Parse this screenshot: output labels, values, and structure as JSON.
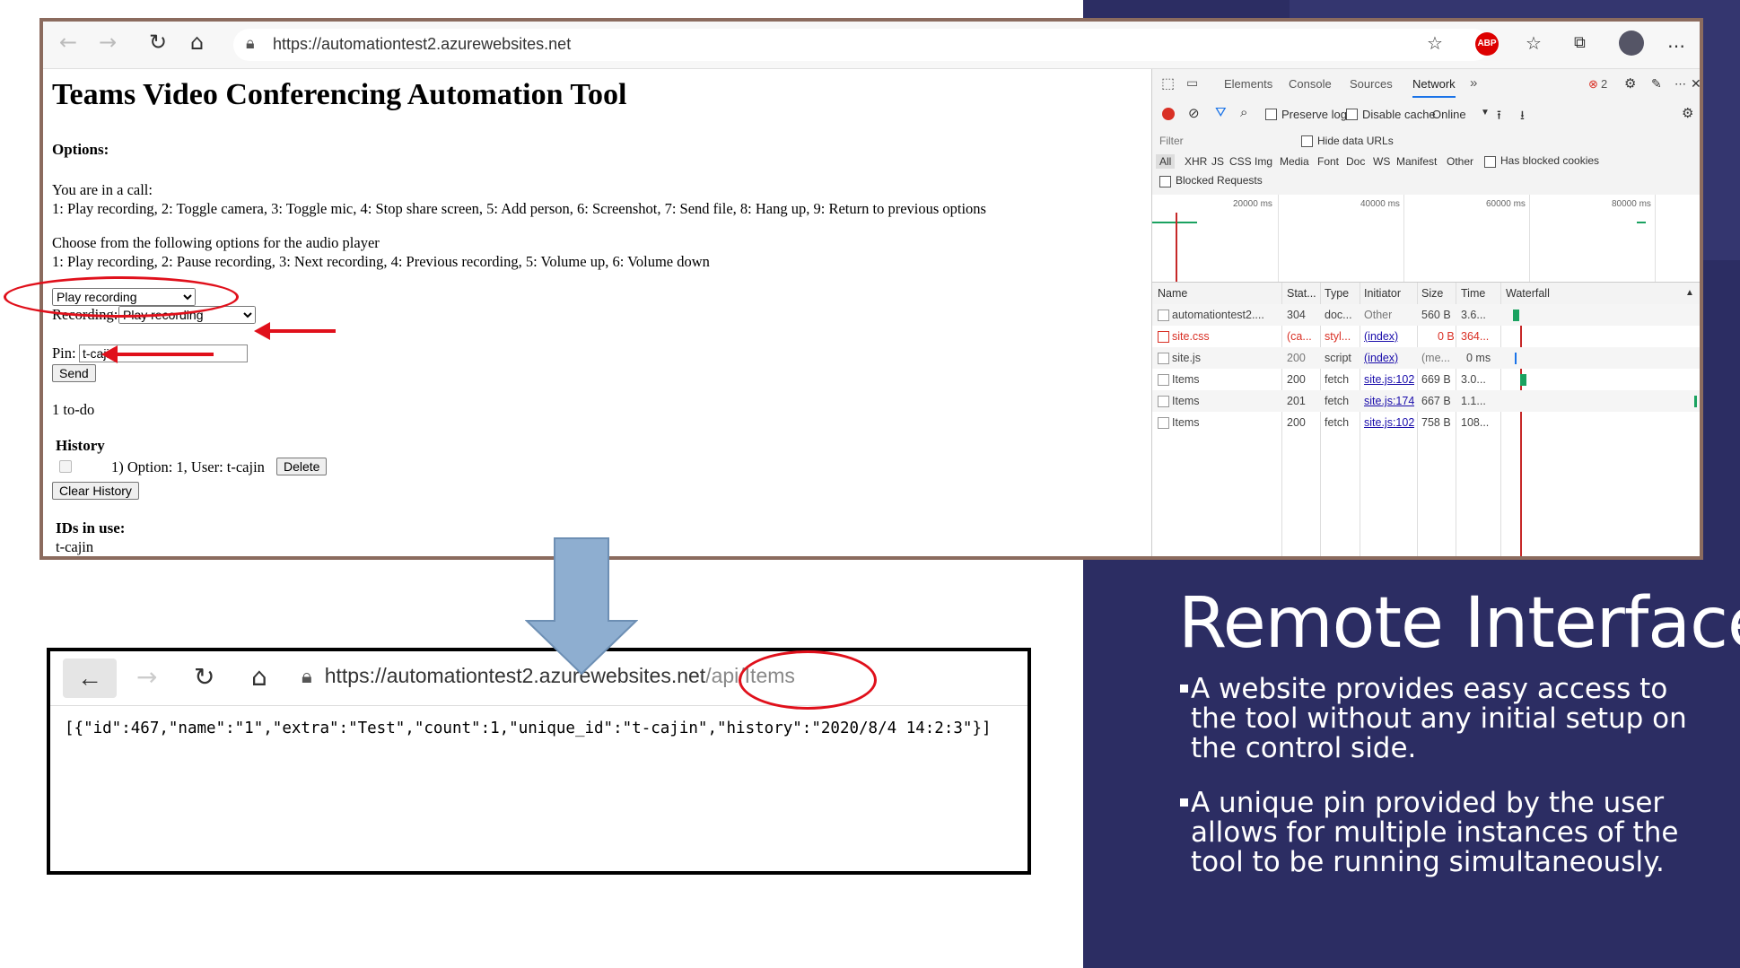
{
  "slide": {
    "title": "Remote Interface",
    "bullets": [
      "A website provides easy access to the tool without any initial setup on the control side.",
      "A unique pin provided by the user  allows for multiple instances of the tool to be running simultaneously."
    ]
  },
  "browser_top": {
    "url": "https://automationtest2.azurewebsites.net",
    "page": {
      "title": "Teams Video Conferencing Automation Tool",
      "options_heading": "Options:",
      "in_call_text": "You are in a call:",
      "call_options": "1: Play recording, 2: Toggle camera, 3: Toggle mic, 4: Stop share screen, 5: Add person, 6: Screenshot, 7: Send file, 8: Hang up, 9: Return to previous options",
      "audio_prompt": "Choose from the following options for the audio player",
      "audio_options": "1: Play recording, 2: Pause recording, 3: Next recording, 4: Previous recording, 5: Volume up, 6: Volume down",
      "action_select_value": "Play recording",
      "recording_label": "Recording:",
      "recording_select_value": "Play recording",
      "pin_label": "Pin:",
      "pin_value": "t-cajin",
      "send_button": "Send",
      "todo_text": "1 to-do",
      "history_heading": "History",
      "history_item": "1) Option: 1, User: t-cajin",
      "delete_button": "Delete",
      "clear_history_button": "Clear History",
      "ids_heading": "IDs in use:",
      "ids_value": "t-cajin"
    },
    "devtools": {
      "tabs": [
        "Elements",
        "Console",
        "Sources",
        "Network"
      ],
      "active_tab": "Network",
      "more_tabs": "»",
      "error_count": "2",
      "preserve_log": "Preserve log",
      "disable_cache": "Disable cache",
      "throttle": "Online",
      "filter_placeholder": "Filter",
      "hide_data_urls": "Hide data URLs",
      "filter_types": [
        "All",
        "XHR",
        "JS",
        "CSS",
        "Img",
        "Media",
        "Font",
        "Doc",
        "WS",
        "Manifest",
        "Other"
      ],
      "has_blocked_cookies": "Has blocked cookies",
      "blocked_requests": "Blocked Requests",
      "timeline_labels": [
        "20000 ms",
        "40000 ms",
        "60000 ms",
        "80000 ms"
      ],
      "columns": [
        "Name",
        "Stat...",
        "Type",
        "Initiator",
        "Size",
        "Time",
        "Waterfall"
      ],
      "rows": [
        {
          "name": "automationtest2....",
          "status": "304",
          "type": "doc...",
          "initiator": "Other",
          "size": "560 B",
          "time": "3.6..."
        },
        {
          "name": "site.css",
          "status": "(ca...",
          "type": "styl...",
          "initiator": "(index)",
          "size": "0 B",
          "time": "364..."
        },
        {
          "name": "site.js",
          "status": "200",
          "type": "script",
          "initiator": "(index)",
          "size": "(me...",
          "time": "0 ms"
        },
        {
          "name": "Items",
          "status": "200",
          "type": "fetch",
          "initiator": "site.js:102",
          "size": "669 B",
          "time": "3.0..."
        },
        {
          "name": "Items",
          "status": "201",
          "type": "fetch",
          "initiator": "site.js:174",
          "size": "667 B",
          "time": "1.1..."
        },
        {
          "name": "Items",
          "status": "200",
          "type": "fetch",
          "initiator": "site.js:102",
          "size": "758 B",
          "time": "108..."
        }
      ]
    }
  },
  "browser_bottom": {
    "url_base": "https://automationtest2.azurewebsites.net",
    "url_path": "/api/Items",
    "json_text": "[{\"id\":467,\"name\":\"1\",\"extra\":\"Test\",\"count\":1,\"unique_id\":\"t-cajin\",\"history\":\"2020/8/4 14:2:3\"}]"
  },
  "icons": {
    "back": "back-arrow-icon",
    "forward": "forward-arrow-icon",
    "refresh": "refresh-icon",
    "home": "home-icon",
    "lock": "lock-icon",
    "star": "star-icon",
    "adblock": "ABP"
  },
  "colors": {
    "slide_panel": "#2c2d63",
    "annotation_red": "#e0101b",
    "arrow_blue": "#8eaed0",
    "waterfall_green": "#1aa260"
  }
}
